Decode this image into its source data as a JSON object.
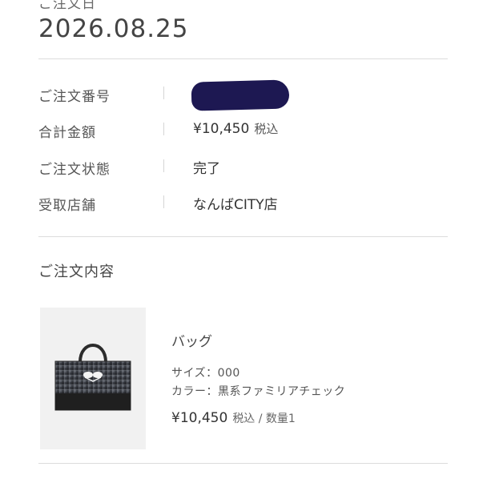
{
  "order": {
    "date_label": "ご注文日",
    "date": "2026.08.25"
  },
  "details": [
    {
      "label": "ご注文番号",
      "value": ""
    },
    {
      "label": "合計金額",
      "value": "¥10,450",
      "suffix": "税込"
    },
    {
      "label": "ご注文状態",
      "value": "完了"
    },
    {
      "label": "受取店舗",
      "value": "なんばCITY店"
    }
  ],
  "redaction": {
    "color": "#1d1852"
  },
  "contents": {
    "title": "ご注文内容",
    "item": {
      "name": "バッグ",
      "size": "サイズ：000",
      "color": "カラー：黒系ファミリアチェック",
      "price": "¥10,450",
      "price_suffix": "税込 / 数量1"
    }
  }
}
